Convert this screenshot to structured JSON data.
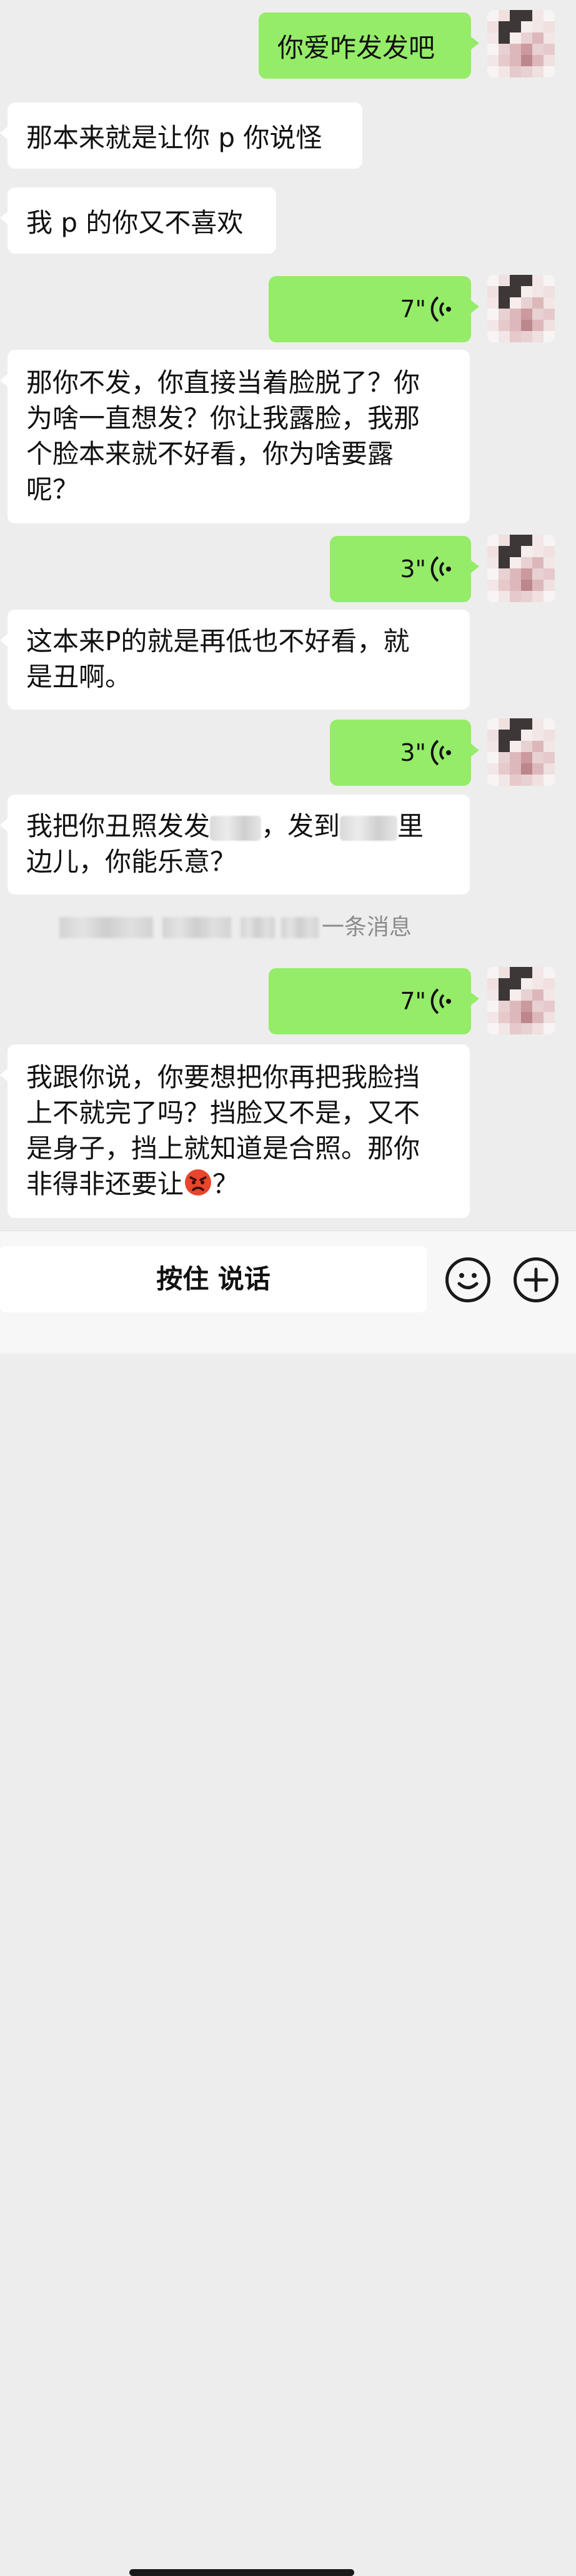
{
  "messages": [
    {
      "side": "out",
      "type": "text",
      "lines": [
        "你爱咋发发吧"
      ]
    },
    {
      "side": "in",
      "type": "text",
      "lines": [
        "那本来就是让你 p 你说怪"
      ]
    },
    {
      "side": "in",
      "type": "text",
      "lines": [
        "我 p 的你又不喜欢"
      ]
    },
    {
      "side": "out",
      "type": "voice",
      "duration": "7\""
    },
    {
      "side": "in",
      "type": "text",
      "lines": [
        "那你不发，你直接当着脸脱了？你",
        "为啥一直想发？你让我露脸，我那",
        "个脸本来就不好看，你为啥要露",
        "呢？"
      ]
    },
    {
      "side": "out",
      "type": "voice",
      "duration": "3\""
    },
    {
      "side": "in",
      "type": "text",
      "lines": [
        "这本来P的就是再低也不好看，就",
        "是丑啊。"
      ]
    },
    {
      "side": "out",
      "type": "voice",
      "duration": "3\""
    },
    {
      "side": "in",
      "type": "text",
      "lines": [
        "我把你丑照发发",
        "，发到",
        "里",
        "边儿，你能乐意？"
      ]
    },
    {
      "side": "out",
      "type": "voice",
      "duration": "7\""
    },
    {
      "side": "in",
      "type": "text",
      "lines": [
        "我跟你说，你要想把你再把我脸挡",
        "上不就完了吗？挡脸又不是，又不",
        "是身子，挡上就知道是合照。那你",
        "非得非还要让",
        "？"
      ],
      "emoji": "angry-face"
    }
  ],
  "system_notice": "一条消息",
  "input_bar": {
    "talk_label": "按住 说话",
    "emoji_icon": "smiley-icon",
    "plus_icon": "plus-icon"
  },
  "colors": {
    "background": "#ededed",
    "incoming_bubble": "#ffffff",
    "outgoing_bubble": "#95ec69"
  }
}
